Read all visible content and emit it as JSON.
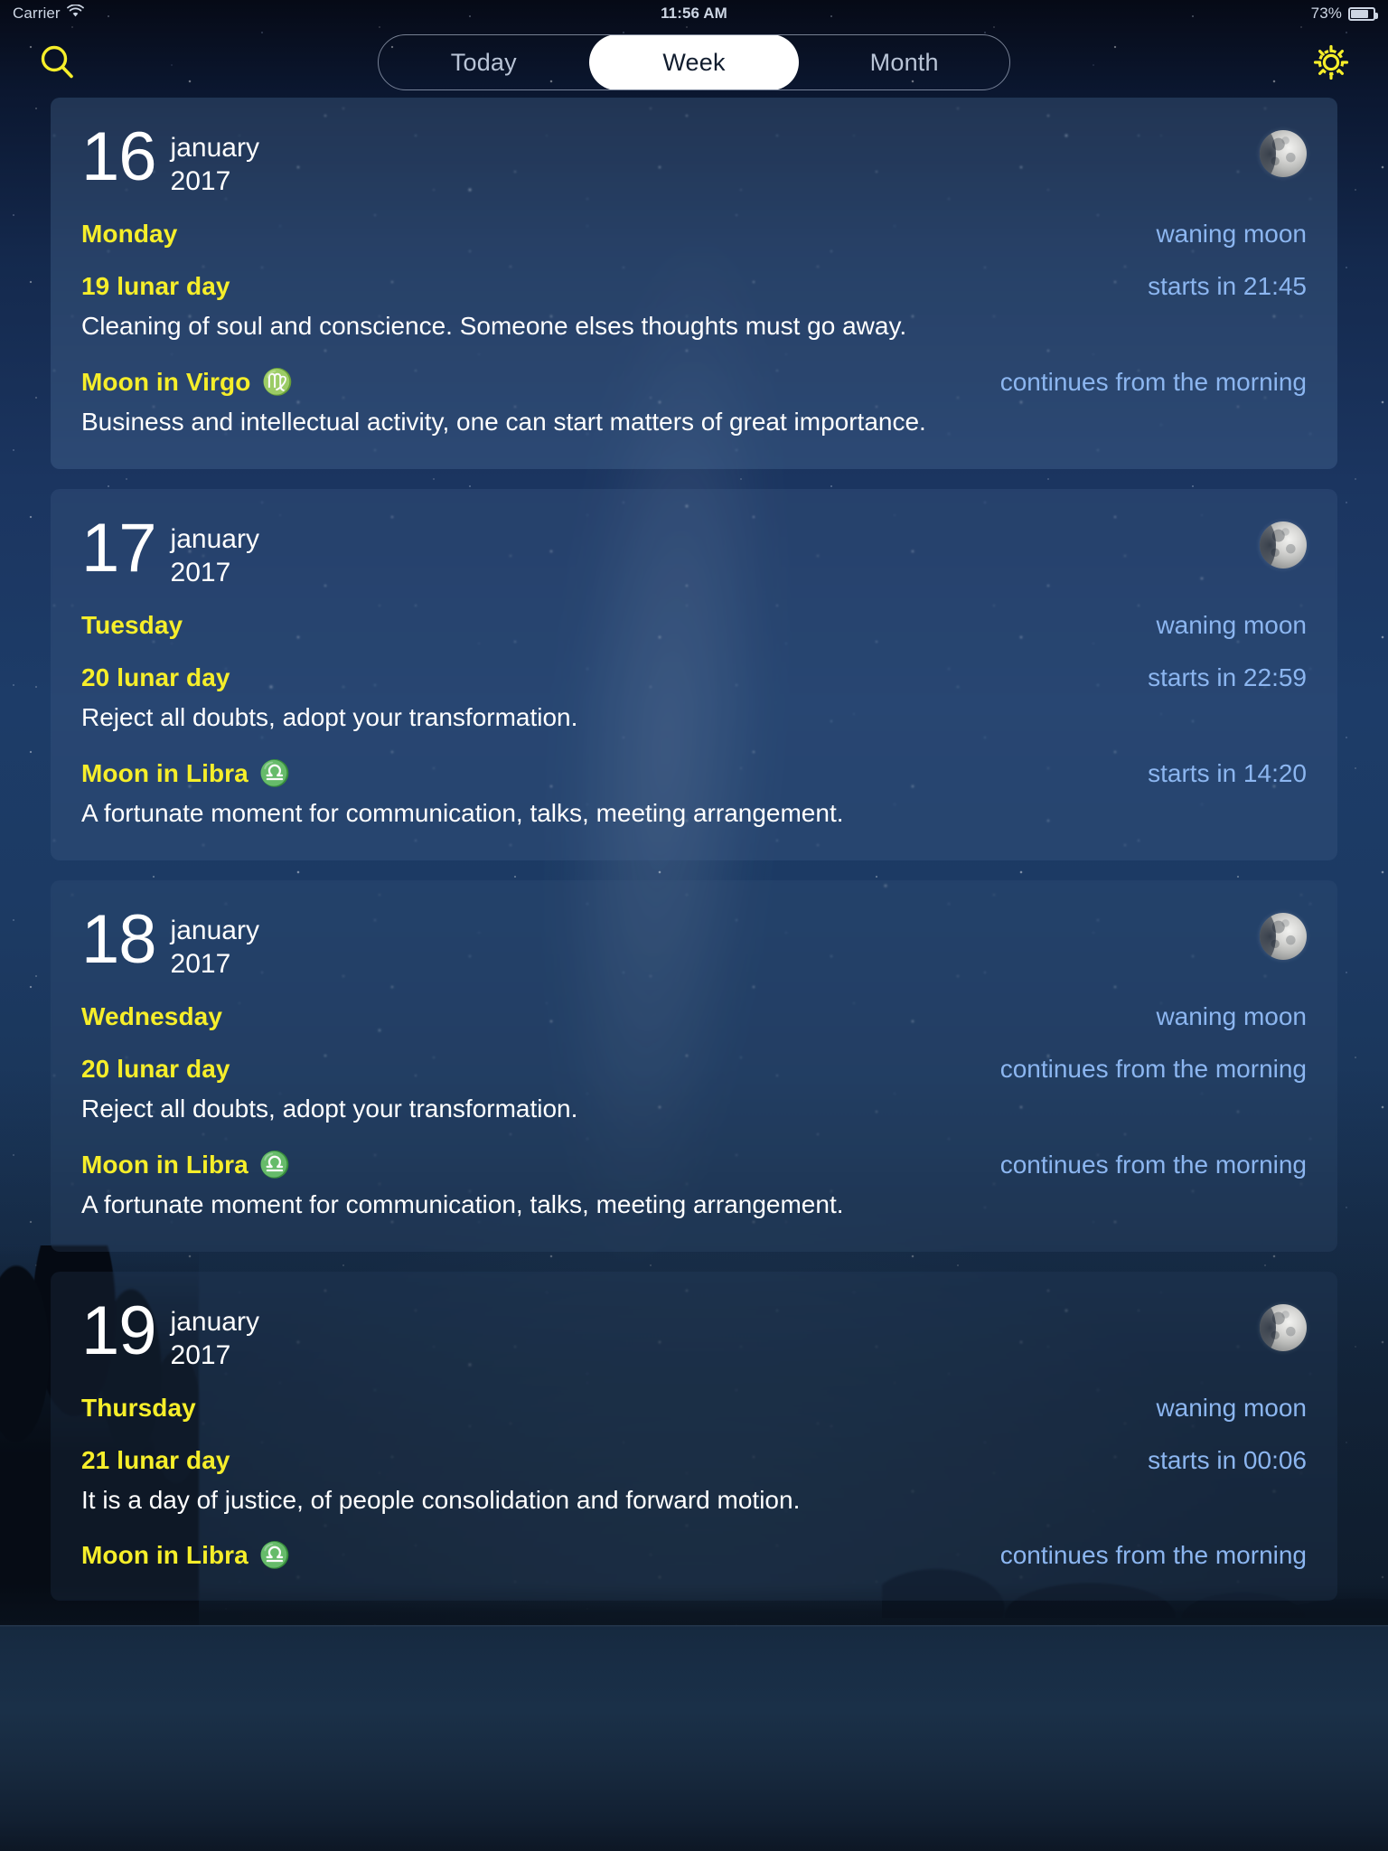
{
  "status_bar": {
    "carrier": "Carrier",
    "wifi_icon": "wifi-icon",
    "time": "11:56 AM",
    "battery_percent": "73%",
    "battery_icon": "battery-icon"
  },
  "nav": {
    "search_icon": "search-icon",
    "settings_icon": "gear-icon",
    "segments": [
      {
        "label": "Today",
        "selected": false
      },
      {
        "label": "Week",
        "selected": true
      },
      {
        "label": "Month",
        "selected": false
      }
    ]
  },
  "colors": {
    "accent_yellow": "#f6ee2a",
    "accent_blue": "#8cb6f0",
    "text_white": "#ffffff",
    "card_bg": "rgba(86,123,166,0.30)"
  },
  "days": [
    {
      "day": "16",
      "month": "january",
      "year": "2017",
      "weekday": "Monday",
      "moon_phase": "waning moon",
      "moon_icon": "moon-waning-gibbous-icon",
      "lunar_day": "19 lunar day",
      "lunar_day_time": "starts in 21:45",
      "lunar_day_desc": "Cleaning of soul and conscience. Someone elses thoughts must go away.",
      "moon_sign": "Moon in Virgo",
      "moon_sign_glyph": "♍",
      "moon_sign_time": "continues from the morning",
      "moon_sign_desc": "Business and intellectual activity, one can start matters of great importance."
    },
    {
      "day": "17",
      "month": "january",
      "year": "2017",
      "weekday": "Tuesday",
      "moon_phase": "waning moon",
      "moon_icon": "moon-waning-gibbous-icon",
      "lunar_day": "20 lunar day",
      "lunar_day_time": "starts in 22:59",
      "lunar_day_desc": "Reject all doubts, adopt your transformation.",
      "moon_sign": "Moon in Libra",
      "moon_sign_glyph": "♎",
      "moon_sign_time": "starts in 14:20",
      "moon_sign_desc": "A fortunate moment for communication, talks, meeting arrangement."
    },
    {
      "day": "18",
      "month": "january",
      "year": "2017",
      "weekday": "Wednesday",
      "moon_phase": "waning moon",
      "moon_icon": "moon-waning-gibbous-icon",
      "lunar_day": "20 lunar day",
      "lunar_day_time": "continues from the morning",
      "lunar_day_desc": "Reject all doubts, adopt your transformation.",
      "moon_sign": "Moon in Libra",
      "moon_sign_glyph": "♎",
      "moon_sign_time": "continues from the morning",
      "moon_sign_desc": "A fortunate moment for communication, talks, meeting arrangement."
    },
    {
      "day": "19",
      "month": "january",
      "year": "2017",
      "weekday": "Thursday",
      "moon_phase": "waning moon",
      "moon_icon": "moon-waning-gibbous-icon",
      "lunar_day": "21 lunar day",
      "lunar_day_time": "starts in 00:06",
      "lunar_day_desc": "It is a day of justice, of people consolidation and forward motion.",
      "moon_sign": "Moon in Libra",
      "moon_sign_glyph": "♎",
      "moon_sign_time": "continues from the morning",
      "moon_sign_desc": ""
    }
  ]
}
